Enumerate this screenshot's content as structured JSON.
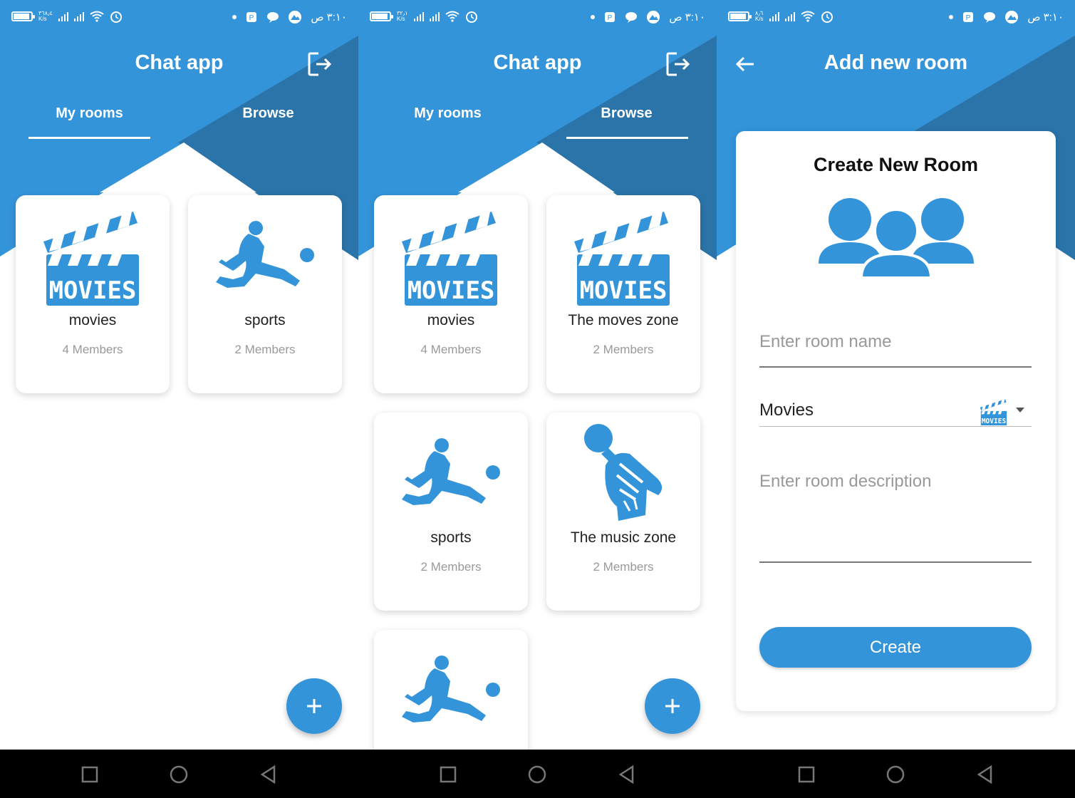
{
  "status_bar": {
    "time": "٣:١٠ ص",
    "speed": "K/s",
    "speeds": [
      "٣٦٨٫٤",
      "٣٢٫١",
      "٨٫٦"
    ]
  },
  "colors": {
    "primary": "#3494DA",
    "primary_dark": "#2B74A9",
    "white": "#FFFFFF"
  },
  "screens": [
    {
      "title": "Chat app",
      "tabs": [
        "My rooms",
        "Browse"
      ],
      "active_tab": 0,
      "cards": [
        {
          "name": "movies",
          "members": "4 Members",
          "icon": "movies-clapperboard-icon"
        },
        {
          "name": "sports",
          "members": "2 Members",
          "icon": "sports-player-icon"
        }
      ]
    },
    {
      "title": "Chat app",
      "tabs": [
        "My rooms",
        "Browse"
      ],
      "active_tab": 1,
      "cards": [
        {
          "name": "movies",
          "members": "4 Members",
          "icon": "movies-clapperboard-icon"
        },
        {
          "name": "The moves zone",
          "members": "2 Members",
          "icon": "movies-clapperboard-icon"
        },
        {
          "name": "sports",
          "members": "2 Members",
          "icon": "sports-player-icon"
        },
        {
          "name": "The music zone",
          "members": "2 Members",
          "icon": "music-fist-mic-icon"
        },
        {
          "name": "",
          "members": "",
          "icon": "sports-player-icon"
        }
      ]
    },
    {
      "title": "Add new room",
      "form": {
        "heading": "Create New Room",
        "room_name_placeholder": "Enter room name",
        "category_value": "Movies",
        "description_placeholder": "Enter room description",
        "button_label": "Create"
      }
    }
  ]
}
